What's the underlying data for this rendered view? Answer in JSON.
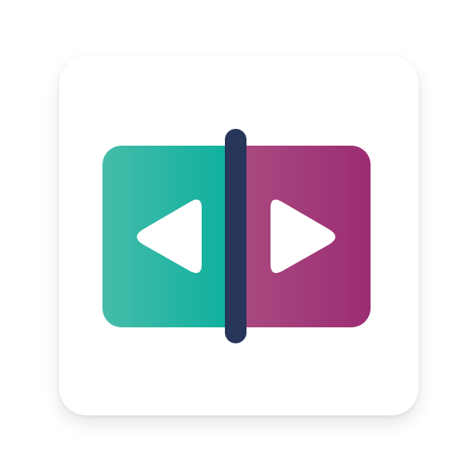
{
  "app_icon": {
    "icon_name": "compare-split-icon",
    "colors": {
      "tile_background": "#ffffff",
      "left_panel_start": "#46bcaa",
      "left_panel_end": "#00ad9a",
      "right_panel_start": "#ad5185",
      "right_panel_end": "#9b2c72",
      "divider": "#27365a",
      "arrow_fill": "#ffffff"
    },
    "left_arrow_icon": "play-left-icon",
    "right_arrow_icon": "play-right-icon",
    "divider_icon": "split-divider-icon"
  }
}
